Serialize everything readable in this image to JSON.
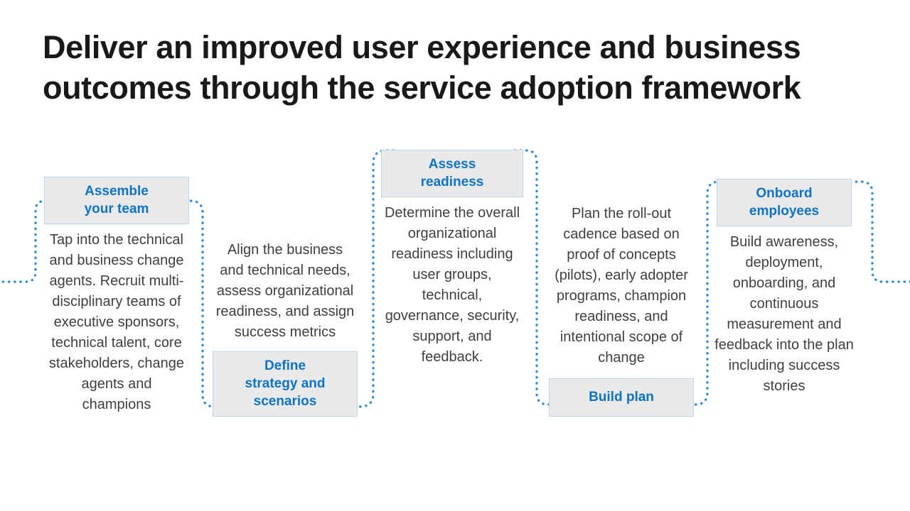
{
  "slide": {
    "title": "Deliver an improved user experience and business\noutcomes through the service adoption framework",
    "background_color": "#FFFFFF",
    "title_color": "#191919",
    "accent_color": "#0D73C4",
    "label_fill_color": "#E9E9E9",
    "label_border_color": "#9CC3E5",
    "body_text_color": "#3F3F3F",
    "connector_color": "#2E8BD6"
  },
  "diagram_data": {
    "type": "process-flow",
    "orientation": "horizontal",
    "stage_count": 5,
    "connector_style": "dotted-curve",
    "stages": [
      {
        "id": "assemble-your-team",
        "index": 1,
        "label": "Assemble\nyour team",
        "label_position": "top",
        "body": "Tap into the technical and business change agents. Recruit multi-disciplinary teams of executive sponsors, technical talent, core stakeholders, change agents and champions"
      },
      {
        "id": "define-strategy-and-scenarios",
        "index": 2,
        "label": "Define\nstrategy and\nscenarios",
        "label_position": "bottom",
        "body": "Align the business and technical needs, assess organizational readiness, and assign success metrics"
      },
      {
        "id": "assess-readiness",
        "index": 3,
        "label": "Assess\nreadiness",
        "label_position": "top",
        "body": "Determine the overall organizational readiness including user groups, technical, governance, security, support, and feedback."
      },
      {
        "id": "build-plan",
        "index": 4,
        "label": "Build plan",
        "label_position": "bottom",
        "body": "Plan the roll-out cadence based on proof of concepts (pilots), early adopter programs, champion readiness, and intentional scope of change"
      },
      {
        "id": "onboard-employees",
        "index": 5,
        "label": "Onboard\nemployees",
        "label_position": "top",
        "body": "Build awareness, deployment, onboarding, and continuous measurement and feedback into the plan including success stories"
      }
    ]
  }
}
